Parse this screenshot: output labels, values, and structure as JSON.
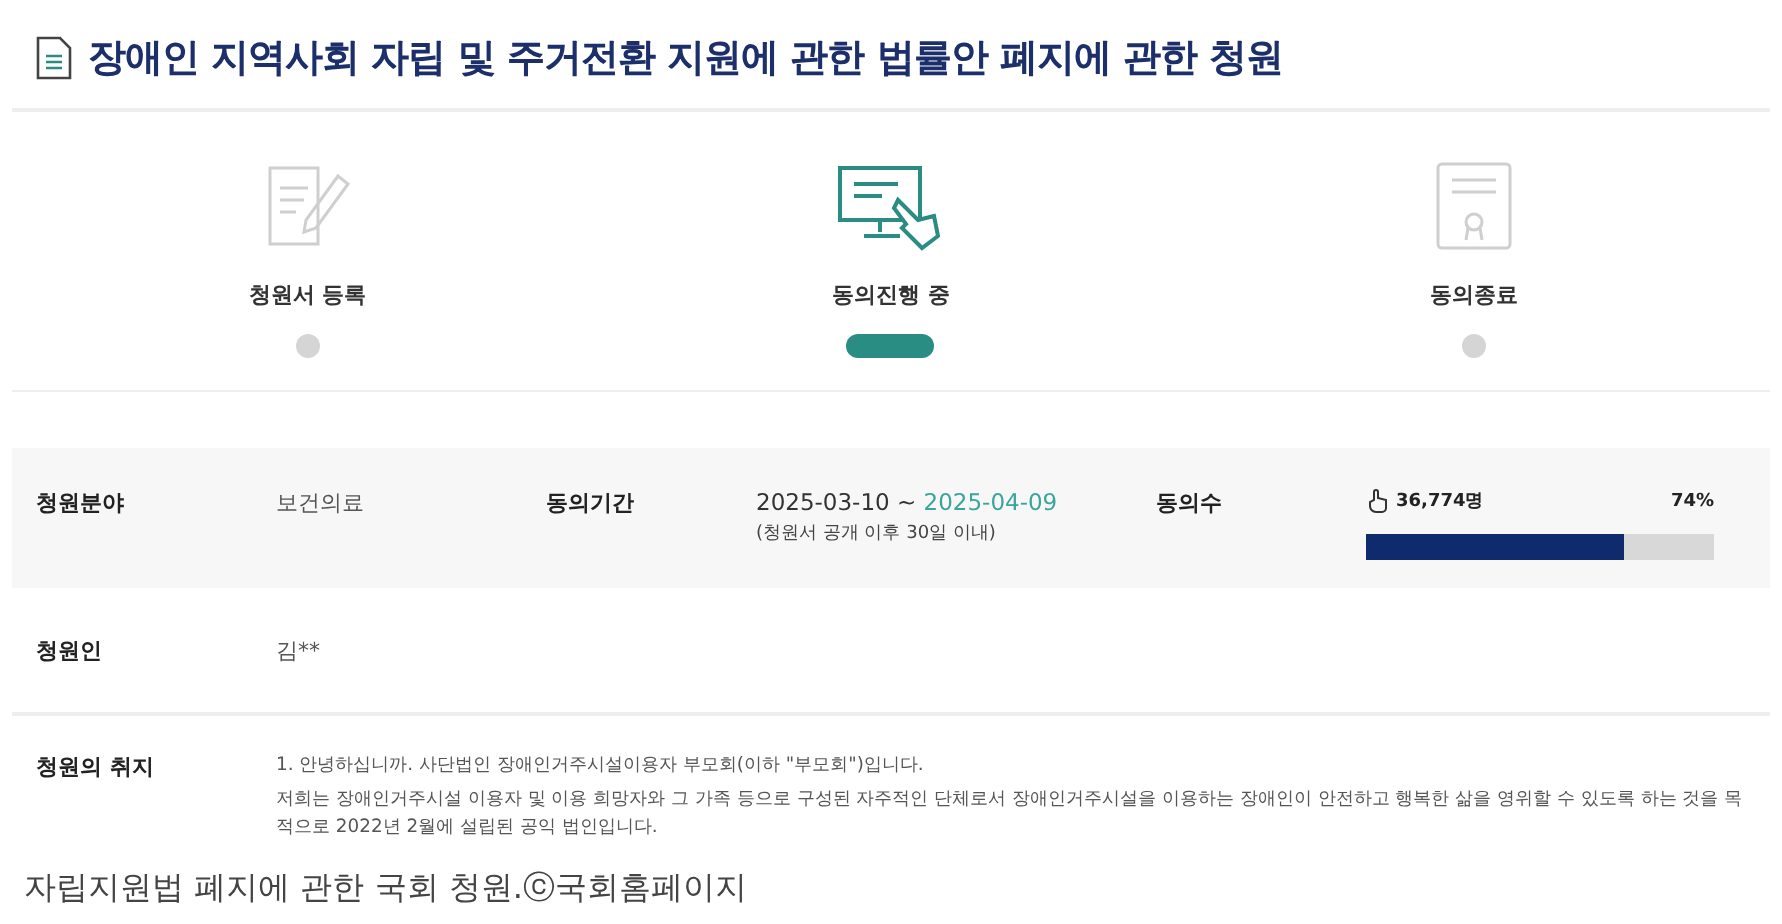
{
  "title": "장애인 지역사회 자립 및 주거전환 지원에 관한 법률안 폐지에 관한 청원",
  "steps": [
    {
      "kind": "register",
      "label": "청원서 등록",
      "selected": false
    },
    {
      "kind": "agree",
      "label": "동의진행 중",
      "selected": true
    },
    {
      "kind": "end",
      "label": "동의종료",
      "selected": false
    }
  ],
  "info": {
    "field_label": "청원분야",
    "field_value": "보건의료",
    "period_label": "동의기간",
    "period_start": "2025-03-10 ~",
    "period_end": "2025-04-09",
    "period_note": "(청원서 공개 이후 30일 이내)",
    "count_label": "동의수",
    "count": "36,774명",
    "percent": "74%",
    "level": 0.74
  },
  "petitioner": {
    "label": "청원인",
    "value": "김**"
  },
  "purpose": {
    "label": "청원의 취지",
    "paragraphs": [
      "1. 안녕하십니까. 사단법인 장애인거주시설이용자 부모회(이하 \"부모회\")입니다.",
      "저희는 장애인거주시설 이용자 및 이용 희망자와 그 가족 등으로 구성된 자주적인 단체로서 장애인거주시설을 이용하는 장애인이 안전하고 행복한 삶을 영위할 수 있도록 하는 것을 목적으로 2022년 2월에 설립된 공익 법인입니다."
    ]
  },
  "caption": "자립지원법 폐지에 관한 국회 청원.ⓒ국회홈페이지"
}
